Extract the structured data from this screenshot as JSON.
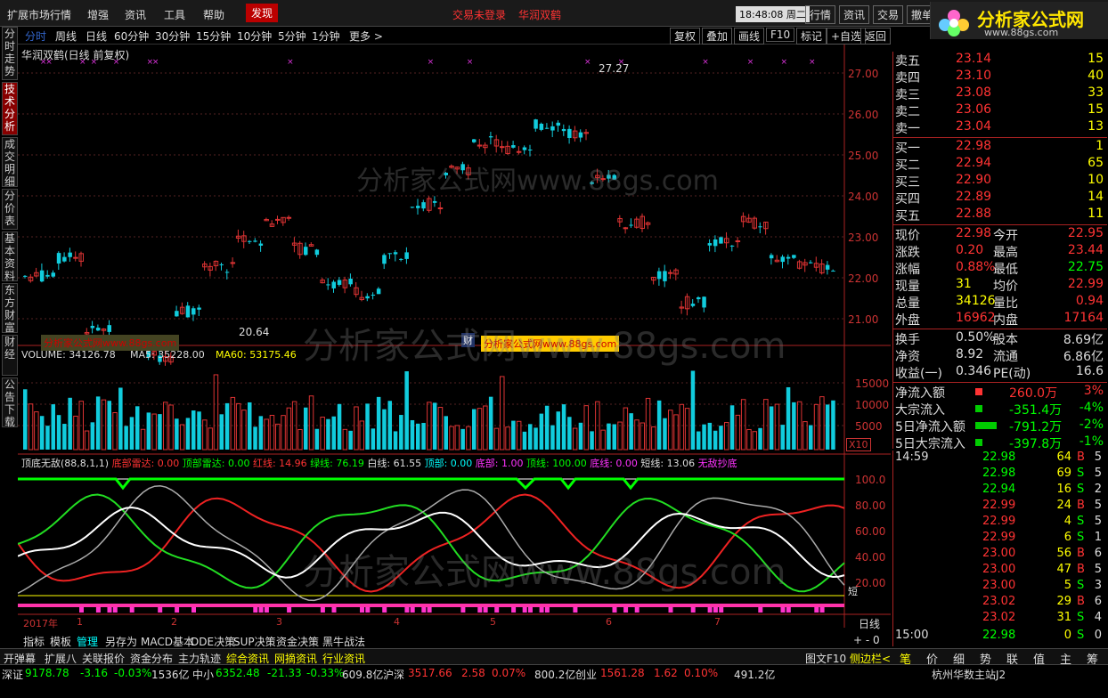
{
  "menubar": {
    "items": [
      "扩展市场行情",
      "增强",
      "资讯",
      "工具",
      "帮助"
    ],
    "discover": "发现",
    "warning_login": "交易未登录",
    "warning_stock": "华润双鹤",
    "clock": "18:48:08 周二",
    "right_tabs": [
      "行情",
      "资讯",
      "交易",
      "撤单"
    ]
  },
  "logo": {
    "name": "分析家公式网",
    "url": "www.88gs.com"
  },
  "periods": [
    "分时",
    "周线",
    "日线",
    "60分钟",
    "30分钟",
    "15分钟",
    "10分钟",
    "5分钟",
    "1分钟",
    "更多 >"
  ],
  "toolbar": [
    "复权",
    "叠加",
    "画线",
    "F10",
    "标记",
    "+自选",
    "返回"
  ],
  "left_tabs": [
    "分时走势",
    "技术分析",
    "成交明细",
    "分价表",
    "基本资料",
    "东方财富",
    "财经",
    "公告下载"
  ],
  "chart": {
    "title": "华润双鹤(日线 前复权)",
    "high_label": "27.27",
    "low_label": "20.64",
    "fin_badge": "财",
    "y_labels": [
      "27.00",
      "26.00",
      "25.00",
      "24.00",
      "23.00",
      "22.00",
      "21.00"
    ],
    "volume_title": {
      "v": "VOLUME: 34126.78",
      "ma5": "MA5: 35228.00",
      "ma60": "MA60: 53175.46"
    },
    "vol_labels": [
      "15000",
      "10000",
      "5000"
    ],
    "vol_unit": "X10",
    "ind_title": {
      "name": "顶底无敌(88,8,1,1)",
      "a": "底部雷达: 0.00",
      "b": "顶部雷达: 0.00",
      "c": "红线: 14.96",
      "d": "绿线: 76.19",
      "e": "白线: 61.55",
      "f": "顶部: 0.00",
      "g": "底部: 1.00",
      "h": "顶线: 100.00",
      "i": "底线: 0.00",
      "j": "短线: 13.06",
      "k": "无敌抄底"
    },
    "ind_labels": [
      "100.0",
      "80.00",
      "60.00",
      "40.00",
      "20.00"
    ],
    "ind_tag": "短",
    "x_labels": [
      "2017年",
      "1",
      "2",
      "3",
      "4",
      "5",
      "6",
      "7"
    ],
    "period_tag": "日线",
    "wm1": "分析家公式网www.88gs.com",
    "wm2": "分析家公式网www.88gs.com",
    "wm3": "分析家公式网www.88gs.com",
    "badge1": "分析家公式网www.88gs.com",
    "badge2": "分析家公式网www.88gs.com"
  },
  "quote": {
    "asks": [
      [
        "卖五",
        "23.14",
        "15"
      ],
      [
        "卖四",
        "23.10",
        "40"
      ],
      [
        "卖三",
        "23.08",
        "33"
      ],
      [
        "卖二",
        "23.06",
        "15"
      ],
      [
        "卖一",
        "23.04",
        "13"
      ]
    ],
    "bids": [
      [
        "买一",
        "22.98",
        "1"
      ],
      [
        "买二",
        "22.94",
        "65"
      ],
      [
        "买三",
        "22.90",
        "10"
      ],
      [
        "买四",
        "22.89",
        "14"
      ],
      [
        "买五",
        "22.88",
        "11"
      ]
    ],
    "stats": [
      [
        "现价",
        "22.98",
        "今开",
        "22.95"
      ],
      [
        "涨跌",
        "0.20",
        "最高",
        "23.44"
      ],
      [
        "涨幅",
        "0.88%",
        "最低",
        "22.75"
      ],
      [
        "现量",
        "31",
        "均价",
        "22.99"
      ],
      [
        "总量",
        "34126",
        "量比",
        "0.94"
      ],
      [
        "外盘",
        "16962",
        "内盘",
        "17164"
      ]
    ],
    "stats2": [
      [
        "换手",
        "0.50%",
        "股本",
        "8.69亿"
      ],
      [
        "净资",
        "8.92",
        "流通",
        "6.86亿"
      ],
      [
        "收益(一)",
        "0.346",
        "PE(动)",
        "16.6"
      ]
    ],
    "flows": [
      [
        "净流入额",
        "260.0万",
        "3%"
      ],
      [
        "大宗流入",
        "-351.4万",
        "-4%"
      ],
      [
        "5日净流入额",
        "-791.2万",
        "-2%"
      ],
      [
        "5日大宗流入",
        "-397.8万",
        "-1%"
      ]
    ]
  },
  "trades": [
    [
      "14:59",
      "22.98",
      "64",
      "B",
      "5"
    ],
    [
      "",
      "22.98",
      "69",
      "S",
      "5"
    ],
    [
      "",
      "22.94",
      "16",
      "S",
      "2"
    ],
    [
      "",
      "22.99",
      "24",
      "B",
      "5"
    ],
    [
      "",
      "22.99",
      "4",
      "S",
      "5"
    ],
    [
      "",
      "22.99",
      "6",
      "S",
      "1"
    ],
    [
      "",
      "23.00",
      "56",
      "B",
      "6"
    ],
    [
      "",
      "23.00",
      "47",
      "B",
      "5"
    ],
    [
      "",
      "23.00",
      "5",
      "S",
      "3"
    ],
    [
      "",
      "23.02",
      "29",
      "B",
      "6"
    ],
    [
      "",
      "23.02",
      "31",
      "S",
      "4"
    ],
    [
      "15:00",
      "22.98",
      "0",
      "S",
      "0"
    ]
  ],
  "bottom_tabs": [
    "指标",
    "模板",
    "管理",
    "另存为",
    "MACD基本",
    "DDE决策",
    "SUP决策",
    "资金决策",
    "黑牛战法"
  ],
  "right_bottom": {
    "tuwen": "图文F10",
    "cebian": "侧边栏<"
  },
  "navbar": [
    "开弹幕",
    "扩展八",
    "关联报价",
    "资金分布",
    "主力轨迹",
    "综合资讯",
    "网摘资讯",
    "行业资讯"
  ],
  "rnav": [
    "笔",
    "价",
    "细",
    "势",
    "联",
    "值",
    "主",
    "筹"
  ],
  "status": {
    "sz": "深证",
    "sz_v": "9178.78",
    "sz_c": "-3.16",
    "sz_p": "-0.03%",
    "sz_a": "1536亿",
    "zx": "中小",
    "zx_v": "6352.48",
    "zx_c": "-21.33",
    "zx_p": "-0.33%",
    "zx_a": "609.8亿",
    "hs": "沪深",
    "hs_v": "3517.66",
    "hs_c": "2.58",
    "hs_p": "0.07%",
    "hs_a": "800.2亿",
    "cy": "创业",
    "cy_v": "1561.28",
    "cy_c": "1.62",
    "cy_p": "0.10%",
    "cy_a": "491.2亿",
    "server": "杭州华数主站J2"
  },
  "colors": {
    "up": "#ff3333",
    "down": "#00e5ff",
    "panel_border": "#aa2222"
  }
}
